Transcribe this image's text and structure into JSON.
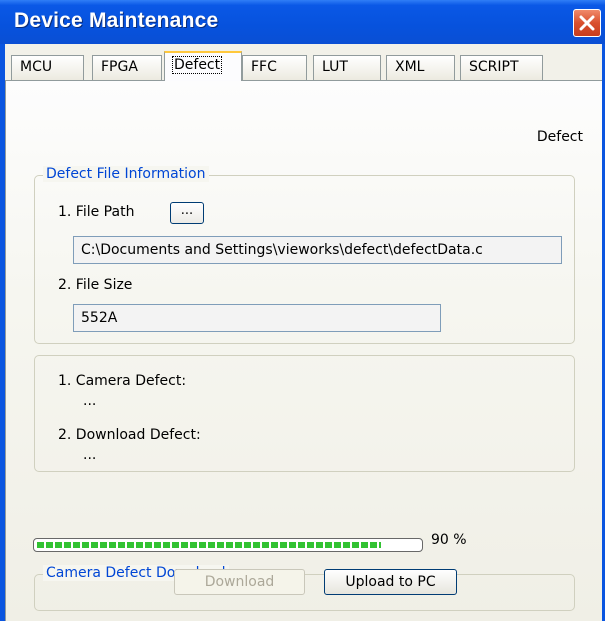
{
  "window": {
    "title": "Device Maintenance"
  },
  "tabs": [
    {
      "label": "MCU"
    },
    {
      "label": "FPGA"
    },
    {
      "label": "Defect"
    },
    {
      "label": "FFC"
    },
    {
      "label": "LUT"
    },
    {
      "label": "XML"
    },
    {
      "label": "SCRIPT"
    }
  ],
  "active_tab": "Defect",
  "page": {
    "caption": "Defect"
  },
  "file_info": {
    "group_title": "Defect File Information",
    "file_path_label": "1. File Path",
    "browse_label": "...",
    "file_path_value": "C:\\Documents and Settings\\vieworks\\defect\\defectData.c",
    "file_size_label": "2. File Size",
    "file_size_value": "552A"
  },
  "defects": {
    "camera_label": "1. Camera Defect:",
    "camera_value": "...",
    "download_label": "2. Download Defect:",
    "download_value": "..."
  },
  "progress": {
    "value": 90,
    "text": "90 %"
  },
  "download_group": {
    "title": "Camera Defect Download",
    "download_label": "Download",
    "upload_label": "Upload to PC"
  },
  "colors": {
    "titlebar": "#0752dd",
    "group_title": "#0046d5",
    "progress_fill": "#32c232",
    "active_tab_highlight": "#ffc83c"
  }
}
